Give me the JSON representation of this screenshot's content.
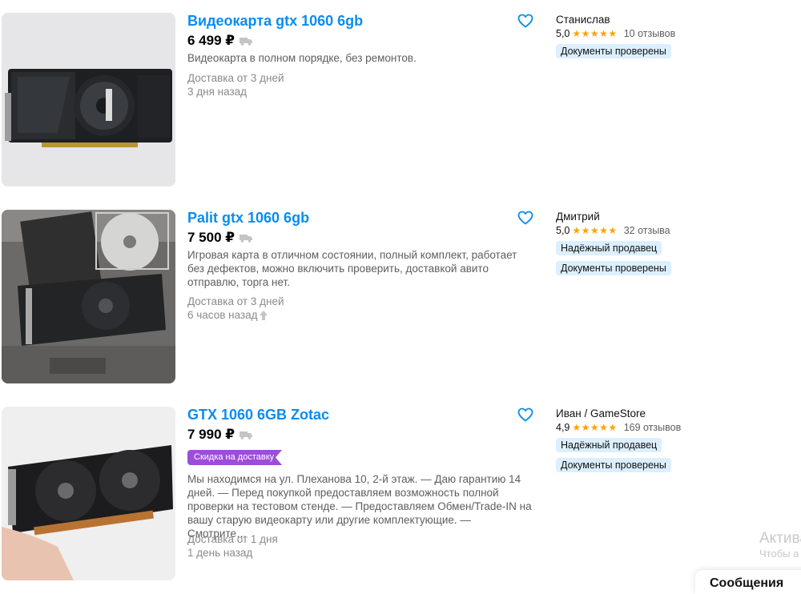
{
  "listings": [
    {
      "title": "Видеокарта gtx 1060 6gb",
      "price": "6 499 ₽",
      "description": "Видеокарта в полном порядке, без ремонтов.",
      "delivery": "Доставка от 3 дней",
      "posted": "3 дня назад",
      "seller": {
        "name": "Станислав",
        "rating": "5,0",
        "stars": "★★★★★",
        "reviews": "10 отзывов",
        "badges": [
          "Документы проверены"
        ]
      }
    },
    {
      "title": "Palit gtx 1060 6gb",
      "price": "7 500 ₽",
      "description": "Игровая карта в отличном состоянии, полный комплект, работает без дефектов, можно включить проверить, доставкой авито отправлю, торга нет.",
      "delivery": "Доставка от 3 дней",
      "posted": "6 часов назад",
      "seller": {
        "name": "Дмитрий",
        "rating": "5,0",
        "stars": "★★★★★",
        "reviews": "32 отзыва",
        "badges": [
          "Надёжный продавец",
          "Документы проверены"
        ]
      }
    },
    {
      "title": "GTX 1060 6GB Zotac",
      "price": "7 990 ₽",
      "promo_badge": "Скидка на доставку",
      "description": "Мы находимся на ул. Плеханова 10, 2-й этаж. — Даю гарантию 14 дней. — Перед покупкой предоставляем возможность полной проверки на тестовом стенде. — Предоставляем Обмен/Trade-IN на вашу старую видеокарту или другие комплектующие. — Смотрите…",
      "delivery": "Доставка от 1 дня",
      "posted": "1 день назад",
      "seller": {
        "name": "Иван / GameStore",
        "rating": "4,9",
        "stars": "★★★★★",
        "reviews": "169 отзывов",
        "badges": [
          "Надёжный продавец",
          "Документы проверены"
        ]
      }
    }
  ],
  "overlay": {
    "activate_title": "Актива",
    "activate_sub": "Чтобы а",
    "messages_tab": "Сообщения"
  },
  "colors": {
    "title_link": "#0a8cf0",
    "badge_bg": "#dcefff",
    "promo_bg": "#9d4dd9",
    "star": "#ffa100"
  },
  "icons": [
    "favorite-heart-icon",
    "delivery-truck-icon",
    "raised-arrow-icon",
    "star-icon"
  ]
}
